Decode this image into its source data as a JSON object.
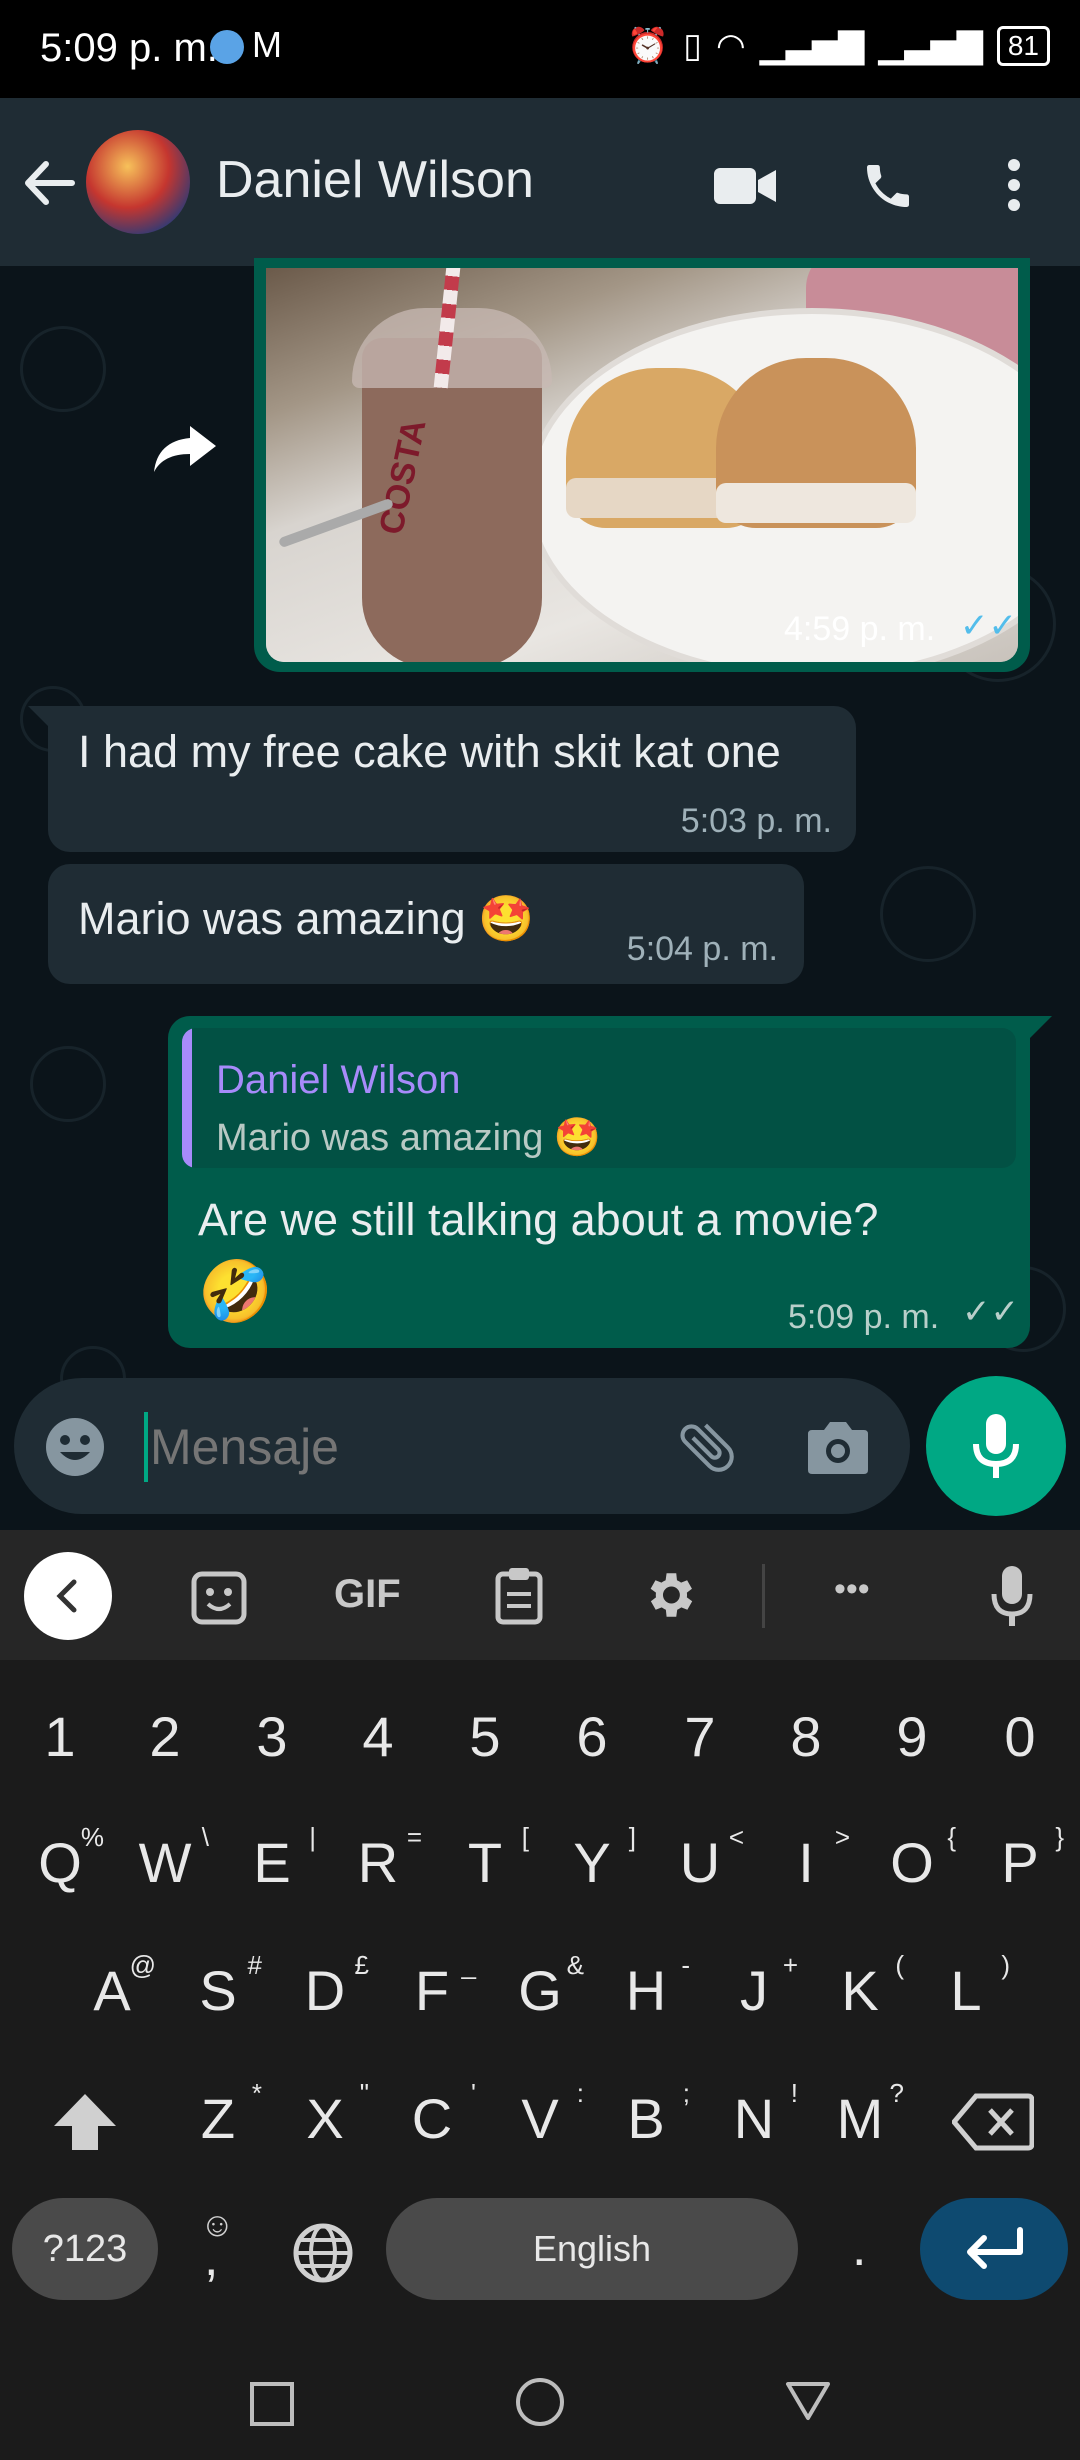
{
  "status_bar": {
    "time": "5:09 p. m.",
    "battery": "81"
  },
  "header": {
    "contact_name": "Daniel Wilson"
  },
  "messages": [
    {
      "type": "image",
      "time": "4:59 p. m."
    },
    {
      "type": "in",
      "text": "I had my free cake with skit kat one",
      "time": "5:03 p. m."
    },
    {
      "type": "in",
      "text": "Mario was amazing 🤩",
      "time": "5:04 p. m."
    },
    {
      "type": "out",
      "quote_author": "Daniel Wilson",
      "quote_text": "Mario was amazing 🤩",
      "text_line1": "Are we still talking about a movie?",
      "text_line2": "🤣",
      "time": "5:09 p. m."
    }
  ],
  "input": {
    "placeholder": "Mensaje"
  },
  "keyboard": {
    "tools": {
      "gif": "GIF",
      "more": "•••"
    },
    "number_row": [
      "1",
      "2",
      "3",
      "4",
      "5",
      "6",
      "7",
      "8",
      "9",
      "0"
    ],
    "row1": [
      "Q",
      "W",
      "E",
      "R",
      "T",
      "Y",
      "U",
      "I",
      "O",
      "P"
    ],
    "row1_alt": [
      "%",
      "\\",
      "|",
      "=",
      "[",
      "]",
      "<",
      ">",
      "{",
      "}"
    ],
    "row2": [
      "A",
      "S",
      "D",
      "F",
      "G",
      "H",
      "J",
      "K",
      "L"
    ],
    "row2_alt": [
      "@",
      "#",
      "£",
      "_",
      "&",
      "-",
      "+",
      "(",
      ")"
    ],
    "row3": [
      "Z",
      "X",
      "C",
      "V",
      "B",
      "N",
      "M"
    ],
    "row3_alt": [
      "*",
      "\"",
      "'",
      ":",
      ";",
      "!",
      "?"
    ],
    "symbols_key": "?123",
    "comma_key": ",",
    "space_label": "English",
    "period_key": "."
  },
  "colors": {
    "header_bg": "#1f2c34",
    "outgoing_bubble": "#005c4b",
    "incoming_bubble": "#1f2c34",
    "accent": "#00a884",
    "read_ticks": "#53bdeb",
    "quote_author": "#a78bfa"
  }
}
